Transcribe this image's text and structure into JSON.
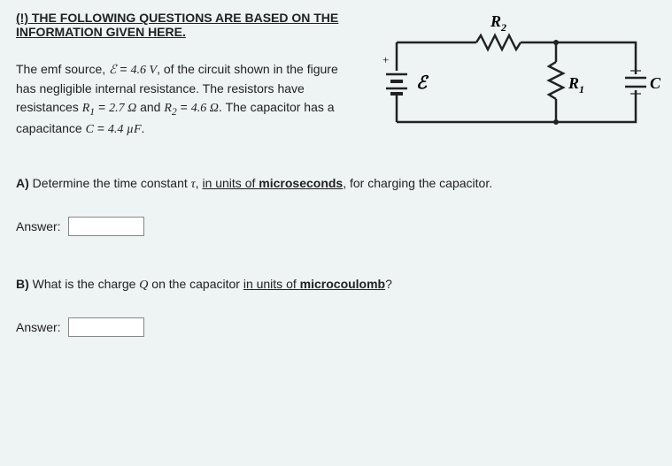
{
  "heading_line1": "(!) THE FOLLOWING QUESTIONS ARE BASED ON THE",
  "heading_line2": "INFORMATION GIVEN HERE.",
  "prob": {
    "t1": "The emf source, ",
    "E": "ℰ",
    "eq1": " = ",
    "Vval": "4.6 V",
    "t2": ", of the circuit shown in the figure has negligible internal resistance. The resistors have resistances ",
    "R1": "R",
    "R1sub": "1",
    "eq2": " = ",
    "R1val": "2.7 Ω",
    "and": " and ",
    "R2": "R",
    "R2sub": "2",
    "eq3": " = ",
    "R2val": "4.6 Ω",
    "t3": ". The capacitor has a capacitance ",
    "C": "C",
    "eq4": " = ",
    "Cval": "4.4 µF",
    "end": "."
  },
  "qa": {
    "labelA": "A)",
    "textA1": " Determine the time constant ",
    "tau": "τ",
    "textA2": ", ",
    "textA3": "in units of ",
    "textA4": "microseconds",
    "textA5": ", for charging the capacitor."
  },
  "qb": {
    "labelB": "B)",
    "textB1": " What is the charge ",
    "Q": "Q",
    "textB2": " on the capacitor ",
    "textB3": "in units of ",
    "textB4": "microcoulomb",
    "textB5": "?"
  },
  "answer_label": "Answer:",
  "circuit": {
    "R2": "R",
    "R2sub": "2",
    "R1": "R",
    "R1sub": "1",
    "E": "ℰ",
    "C": "C",
    "plus": "+"
  }
}
